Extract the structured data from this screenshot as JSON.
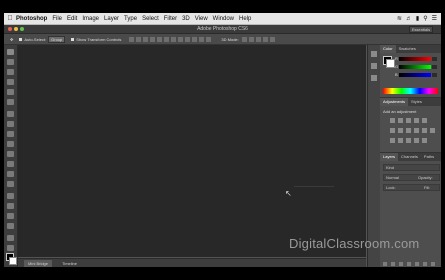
{
  "menubar": {
    "app": "Photoshop",
    "items": [
      "File",
      "Edit",
      "Image",
      "Layer",
      "Type",
      "Select",
      "Filter",
      "3D",
      "View",
      "Window",
      "Help"
    ]
  },
  "window": {
    "title": "Adobe Photoshop CS6",
    "workspace": "Essentials",
    "traffic_colors": [
      "#ee5c50",
      "#f4be3e",
      "#5fc64c"
    ]
  },
  "options": {
    "auto_select_label": "Auto-Select:",
    "auto_select_value": "Group",
    "transform_label": "Show Transform Controls",
    "mode_label": "3D Mode:"
  },
  "panels": {
    "color_tabs": [
      "Color",
      "Swatches"
    ],
    "channels": [
      "R",
      "G",
      "B"
    ],
    "adjust_tabs": [
      "Adjustments",
      "Styles"
    ],
    "add_adjustment": "Add an adjustment",
    "layers_tabs": [
      "Layers",
      "Channels",
      "Paths"
    ],
    "kind_label": "Kind",
    "normal_label": "Normal",
    "opacity_label": "Opacity:",
    "lock_label": "Lock:",
    "fill_label": "Fill:"
  },
  "bottom_tabs": [
    "Mini Bridge",
    "Timeline"
  ],
  "watermark": "DigitalClassroom.com",
  "icons": {
    "apple": "apple-icon",
    "cursor": "arrow-cursor-icon",
    "move_tool": "move-tool-icon"
  }
}
